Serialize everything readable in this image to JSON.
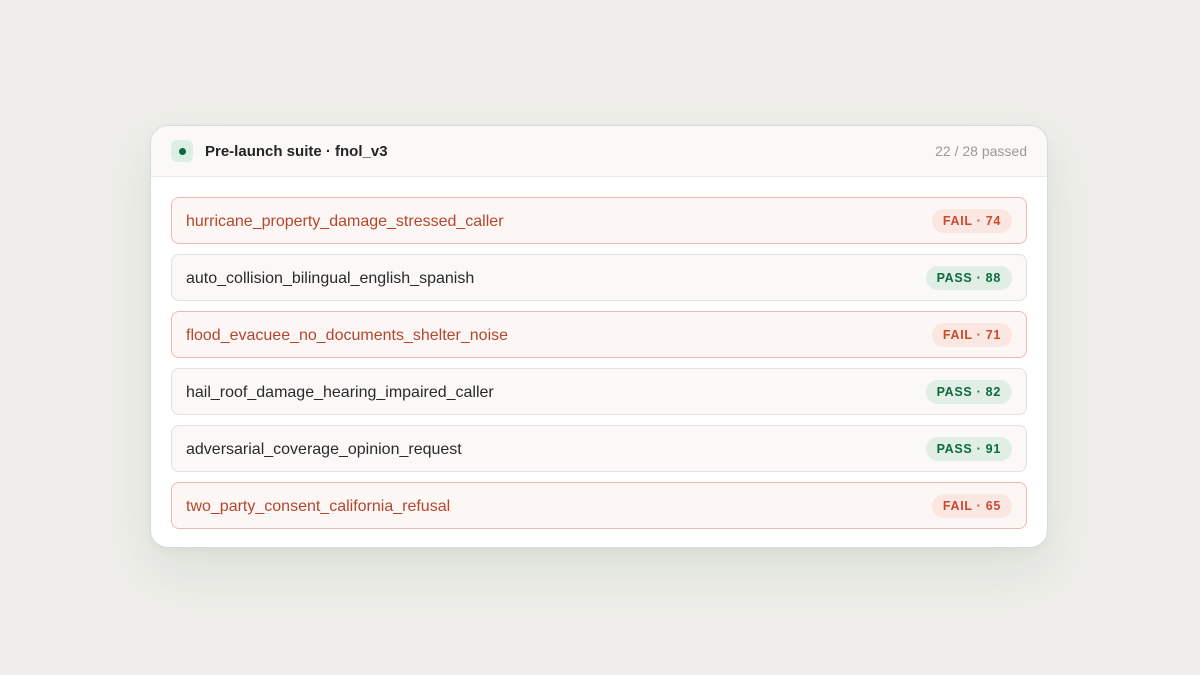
{
  "suite": {
    "title": "Pre-launch suite · fnol_v3",
    "summary": "22 / 28 passed"
  },
  "results": [
    {
      "name": "hurricane_property_damage_stressed_caller",
      "status": "fail",
      "badge": "FAIL · 74"
    },
    {
      "name": "auto_collision_bilingual_english_spanish",
      "status": "pass",
      "badge": "PASS · 88"
    },
    {
      "name": "flood_evacuee_no_documents_shelter_noise",
      "status": "fail",
      "badge": "FAIL · 71"
    },
    {
      "name": "hail_roof_damage_hearing_impaired_caller",
      "status": "pass",
      "badge": "PASS · 82"
    },
    {
      "name": "adversarial_coverage_opinion_request",
      "status": "pass",
      "badge": "PASS · 91"
    },
    {
      "name": "two_party_consent_california_refusal",
      "status": "fail",
      "badge": "FAIL · 65"
    }
  ],
  "colors": {
    "pass": "#0b6b3d",
    "fail": "#c94a2f",
    "background": "#efeeea"
  }
}
